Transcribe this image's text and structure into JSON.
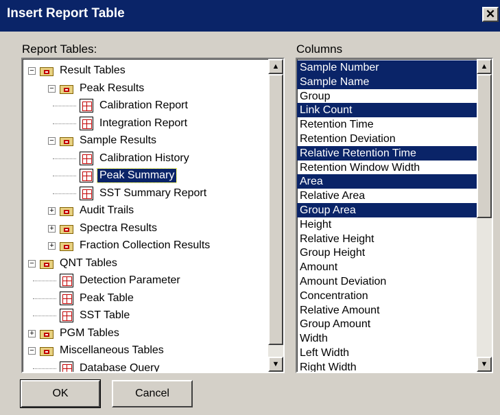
{
  "window": {
    "title": "Insert Report Table",
    "close_glyph": "✕"
  },
  "report_tables": {
    "label": "Report Tables:",
    "items": [
      {
        "label": "Result Tables",
        "icon": "folder-icon",
        "expander": "−"
      },
      {
        "label": "Peak Results",
        "icon": "folder-icon",
        "expander": "−"
      },
      {
        "label": "Calibration Report",
        "icon": "report-icon"
      },
      {
        "label": "Integration Report",
        "icon": "report-icon"
      },
      {
        "label": "Sample Results",
        "icon": "folder-icon",
        "expander": "−"
      },
      {
        "label": "Calibration History",
        "icon": "report-icon"
      },
      {
        "label": "Peak Summary",
        "icon": "report-icon",
        "selected": true
      },
      {
        "label": "SST Summary Report",
        "icon": "report-icon"
      },
      {
        "label": "Audit Trails",
        "icon": "folder-icon",
        "expander": "+"
      },
      {
        "label": "Spectra Results",
        "icon": "folder-icon",
        "expander": "+"
      },
      {
        "label": "Fraction Collection Results",
        "icon": "folder-icon",
        "expander": "+"
      },
      {
        "label": "QNT Tables",
        "icon": "folder-icon",
        "expander": "−"
      },
      {
        "label": "Detection Parameter",
        "icon": "report-icon"
      },
      {
        "label": "Peak Table",
        "icon": "report-icon"
      },
      {
        "label": "SST Table",
        "icon": "report-icon"
      },
      {
        "label": "PGM Tables",
        "icon": "folder-icon",
        "expander": "+"
      },
      {
        "label": "Miscellaneous Tables",
        "icon": "folder-icon",
        "expander": "−"
      },
      {
        "label": "Database Query",
        "icon": "report-icon"
      }
    ]
  },
  "columns": {
    "label": "Columns",
    "items": [
      {
        "label": "Sample Number",
        "selected": true
      },
      {
        "label": "Sample Name",
        "selected": true
      },
      {
        "label": "Group",
        "selected": false
      },
      {
        "label": "Link Count",
        "selected": true
      },
      {
        "label": "Retention Time",
        "selected": false
      },
      {
        "label": "Retention Deviation",
        "selected": false
      },
      {
        "label": "Relative Retention Time",
        "selected": true
      },
      {
        "label": "Retention Window Width",
        "selected": false
      },
      {
        "label": "Area",
        "selected": true
      },
      {
        "label": "Relative Area",
        "selected": false
      },
      {
        "label": "Group Area",
        "selected": true
      },
      {
        "label": "Height",
        "selected": false
      },
      {
        "label": "Relative Height",
        "selected": false
      },
      {
        "label": "Group Height",
        "selected": false
      },
      {
        "label": "Amount",
        "selected": false
      },
      {
        "label": "Amount Deviation",
        "selected": false
      },
      {
        "label": "Concentration",
        "selected": false
      },
      {
        "label": "Relative Amount",
        "selected": false
      },
      {
        "label": "Group Amount",
        "selected": false
      },
      {
        "label": "Width",
        "selected": false
      },
      {
        "label": "Left Width",
        "selected": false
      },
      {
        "label": "Right Width",
        "selected": false
      }
    ]
  },
  "buttons": {
    "ok": "OK",
    "cancel": "Cancel"
  },
  "scroll": {
    "up_glyph": "▲",
    "down_glyph": "▼"
  },
  "colors": {
    "title_bar": "#0a2468",
    "selection": "#0a2468",
    "face": "#d4d0c8"
  }
}
